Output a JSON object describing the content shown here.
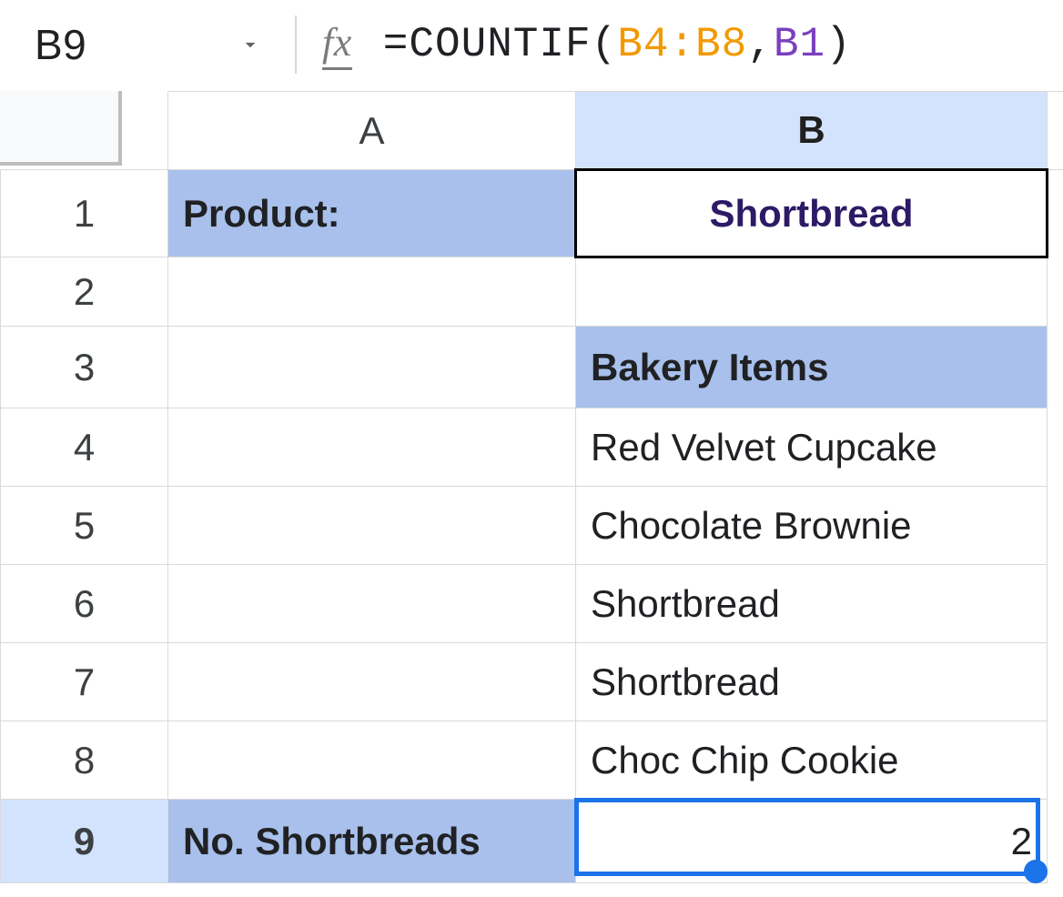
{
  "nameBox": {
    "ref": "B9"
  },
  "formula": {
    "fx_label": "fx",
    "prefix": "=",
    "fn": "COUNTIF",
    "open": "(",
    "arg1": "B4:B8",
    "sep": ",",
    "arg2": "B1",
    "close": ")"
  },
  "columns": {
    "A": "A",
    "B": "B"
  },
  "rowLabels": {
    "1": "1",
    "2": "2",
    "3": "3",
    "4": "4",
    "5": "5",
    "6": "6",
    "7": "7",
    "8": "8",
    "9": "9"
  },
  "cells": {
    "A1": "Product:",
    "B1": "Shortbread",
    "A2": "",
    "B2": "",
    "A3": "",
    "B3": "Bakery Items",
    "A4": "",
    "B4": "Red Velvet Cupcake",
    "A5": "",
    "B5": "Chocolate Brownie",
    "A6": "",
    "B6": "Shortbread",
    "A7": "",
    "B7": "Shortbread",
    "A8": "",
    "B8": "Choc Chip Cookie",
    "A9": "No. Shortbreads",
    "B9": "2"
  },
  "activeCell": "B9",
  "colors": {
    "headerFill": "#a8c0eb",
    "selection": "#1a73e8",
    "colHighlight": "#d3e3fd",
    "formulaArg1": "#f29900",
    "formulaArg2": "#7b3fbf",
    "b1Text": "#2d1a66"
  }
}
